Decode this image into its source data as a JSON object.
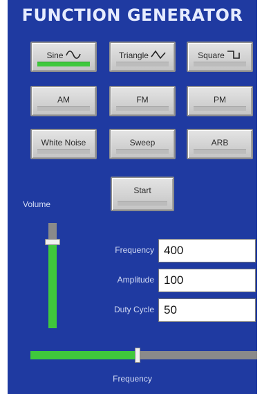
{
  "title": "FUNCTION GENERATOR",
  "waveform_buttons": [
    {
      "label": "Sine",
      "icon": "sine-wave-icon",
      "selected": true
    },
    {
      "label": "Triangle",
      "icon": "triangle-wave-icon",
      "selected": false
    },
    {
      "label": "Square",
      "icon": "square-wave-icon",
      "selected": false
    }
  ],
  "modulation_buttons": [
    {
      "label": "AM"
    },
    {
      "label": "FM"
    },
    {
      "label": "PM"
    }
  ],
  "mode_buttons": [
    {
      "label": "White Noise"
    },
    {
      "label": "Sweep"
    },
    {
      "label": "ARB"
    }
  ],
  "start_button": {
    "label": "Start"
  },
  "volume": {
    "label": "Volume",
    "level": 0.82
  },
  "fields": {
    "frequency": {
      "label": "Frequency",
      "value": "400"
    },
    "amplitude": {
      "label": "Amplitude",
      "value": "100"
    },
    "duty_cycle": {
      "label": "Duty Cycle",
      "value": "50"
    }
  },
  "frequency_slider": {
    "label": "Frequency",
    "level": 0.47
  },
  "colors": {
    "panel": "#1f3aa1",
    "indicator_on": "#3fc83c",
    "indicator_off": "#bcbcbc",
    "slider_track": "#8a8a8a"
  }
}
